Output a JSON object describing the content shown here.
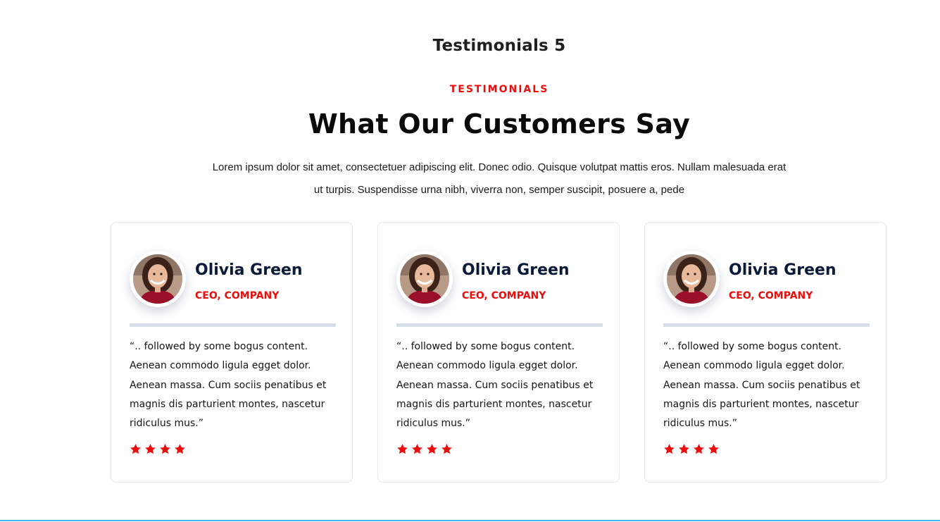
{
  "page": {
    "heading": "Testimonials 5"
  },
  "section": {
    "eyebrow": "TESTIMONIALS",
    "title": "What Our Customers Say",
    "description": "Lorem ipsum dolor sit amet, consectetuer adipiscing elit. Donec odio. Quisque volutpat mattis eros. Nullam malesuada erat ut turpis. Suspendisse urna nibh, viverra non, semper suscipit, posuere a, pede"
  },
  "testimonials": [
    {
      "name": "Olivia Green",
      "role": "CEO, COMPANY",
      "quote": "“.. followed by some bogus content. Aenean commodo ligula egget dolor. Aenean massa. Cum sociis penatibus et magnis dis parturient montes, nascetur ridiculus mus.”",
      "rating": 4,
      "avatar_icon": "woman-portrait-avatar"
    },
    {
      "name": "Olivia Green",
      "role": "CEO, COMPANY",
      "quote": "“.. followed by some bogus content. Aenean commodo ligula egget dolor. Aenean massa. Cum sociis penatibus et magnis dis parturient montes, nascetur ridiculus mus.”",
      "rating": 4,
      "avatar_icon": "woman-portrait-avatar"
    },
    {
      "name": "Olivia Green",
      "role": "CEO, COMPANY",
      "quote": "“.. followed by some bogus content. Aenean commodo ligula egget dolor. Aenean massa. Cum sociis penatibus et magnis dis parturient montes, nascetur ridiculus mus.”",
      "rating": 4,
      "avatar_icon": "woman-portrait-avatar"
    }
  ],
  "colors": {
    "accent": "#ec0c0c",
    "name_text": "#0c1a3a",
    "divider": "#d6deea",
    "star": "#ec0c0c",
    "bottom_border": "#4fb3f0"
  },
  "icons": {
    "star": "star-icon"
  }
}
